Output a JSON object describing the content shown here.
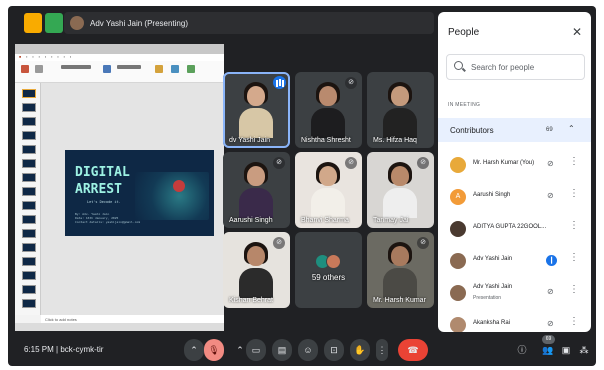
{
  "meeting": {
    "presenter_chip": "Adv Yashi Jain (Presenting)",
    "time": "6:15 PM",
    "code": "bck-cymk-tir",
    "participant_badge": "69"
  },
  "slide": {
    "title": "DIGITAL ARREST",
    "subtitle": "Let's Decode it.",
    "meta_lines": [
      "By: Adv. Yashi Jain",
      "Date: 16th January, 2025",
      "Contact details: yashijain@gmail.com"
    ],
    "notes_placeholder": "Click to add notes"
  },
  "tiles": [
    {
      "name": "dv Yashi Jain",
      "speaking": true
    },
    {
      "name": "Nishtha Shresht"
    },
    {
      "name": "Ms. Hifza Haq"
    },
    {
      "name": "Aarushi Singh"
    },
    {
      "name": "Bhanvi Sharma"
    },
    {
      "name": "Tanmay Jai"
    },
    {
      "name": "Kishan Behrat"
    },
    {
      "name": "59 others"
    },
    {
      "name": "Mr. Harsh Kumar"
    }
  ],
  "people_panel": {
    "title": "People",
    "search_placeholder": "Search for people",
    "section_label": "IN MEETING",
    "group_label": "Contributors",
    "group_count": "69",
    "members": [
      {
        "name": "Mr. Harsh Kumar (You)",
        "avatar_color": "#e8a93a",
        "initial": ""
      },
      {
        "name": "Aarushi Singh",
        "avatar_color": "#f29b38",
        "initial": "A"
      },
      {
        "name": "ADITYA GUPTA 22GOOL...",
        "avatar_color": "#4a3a30",
        "initial": ""
      },
      {
        "name": "Adv Yashi Jain",
        "avatar_color": "#8a6a52",
        "initial": ""
      },
      {
        "name": "Adv Yashi Jain",
        "sub": "Presentation",
        "avatar_color": "#8a6a52",
        "initial": ""
      },
      {
        "name": "Akanksha Rai",
        "avatar_color": "#b08a6e",
        "initial": ""
      }
    ]
  },
  "colors": {
    "background": "#202124",
    "tile": "#3c4043",
    "accent_blue": "#1a73e8",
    "hangup_red": "#ea4335",
    "presenter_yellow": "#f9ab00",
    "presenter_green": "#34a853"
  }
}
